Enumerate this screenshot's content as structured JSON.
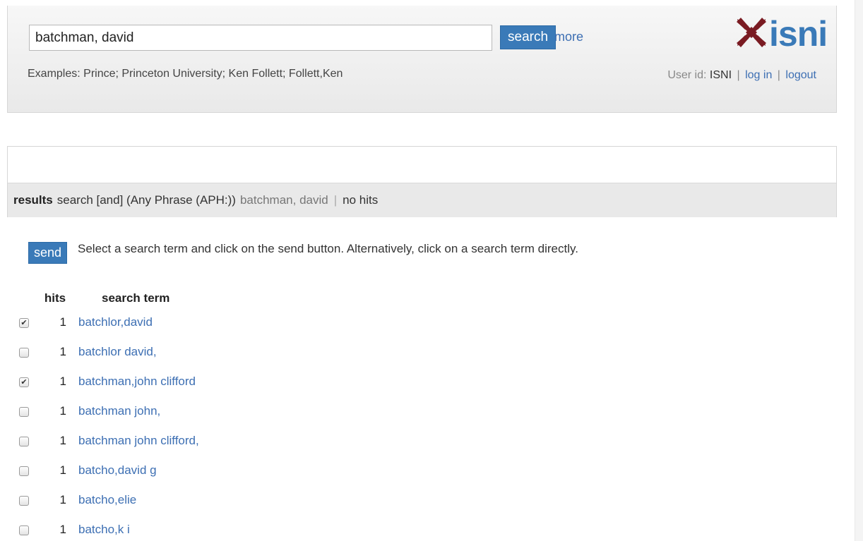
{
  "search": {
    "value": "batchman, david",
    "button_label": "search",
    "more_label": "more",
    "examples": "Examples: Prince; Princeton University; Ken Follett; Follett,Ken"
  },
  "logo": {
    "text": "isni",
    "icon": "isni-x-logo-icon",
    "colors": {
      "mark": "#7a1b22",
      "text": "#3a7ab8"
    }
  },
  "user": {
    "label": "User id:",
    "id": "ISNI",
    "sep": "|",
    "login": "log in",
    "logout": "logout"
  },
  "results": {
    "label": "results",
    "description": "search [and] (Any Phrase (APH:))",
    "query": "batchman, david",
    "sep": "|",
    "status": "no hits"
  },
  "send": {
    "button_label": "send",
    "instructions": "Select a search term and click on the send button. Alternatively, click on a search term directly."
  },
  "table": {
    "headers": {
      "hits": "hits",
      "term": "search term"
    },
    "rows": [
      {
        "checked": true,
        "check_mark": "✔",
        "hits": "1",
        "term": "batchlor,david"
      },
      {
        "checked": false,
        "check_mark": "",
        "hits": "1",
        "term": "batchlor david,"
      },
      {
        "checked": true,
        "check_mark": "✔",
        "hits": "1",
        "term": "batchman,john clifford"
      },
      {
        "checked": false,
        "check_mark": "",
        "hits": "1",
        "term": "batchman john,"
      },
      {
        "checked": false,
        "check_mark": "",
        "hits": "1",
        "term": "batchman john clifford,"
      },
      {
        "checked": false,
        "check_mark": "",
        "hits": "1",
        "term": "batcho,david g"
      },
      {
        "checked": false,
        "check_mark": "",
        "hits": "1",
        "term": "batcho,elie"
      },
      {
        "checked": false,
        "check_mark": "",
        "hits": "1",
        "term": "batcho,k i"
      }
    ]
  },
  "colors": {
    "accent": "#3a7ab8",
    "link": "#3d6fb3"
  }
}
